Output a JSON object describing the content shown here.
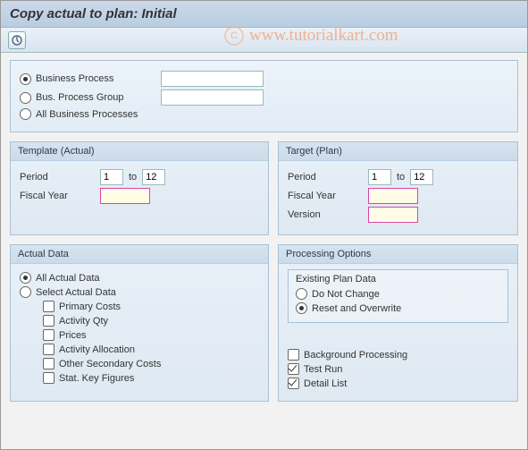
{
  "title": "Copy actual to plan: Initial",
  "watermark": "www.tutorialkart.com",
  "selection": {
    "opt_business_process": "Business Process",
    "opt_bus_process_group": "Bus. Process Group",
    "opt_all_business_processes": "All Business Processes",
    "bp_value": "",
    "bpg_value": ""
  },
  "template": {
    "title": "Template (Actual)",
    "period_label": "Period",
    "period_from": "1",
    "to_label": "to",
    "period_to": "12",
    "fiscal_year_label": "Fiscal Year",
    "fiscal_year_value": ""
  },
  "target": {
    "title": "Target (Plan)",
    "period_label": "Period",
    "period_from": "1",
    "to_label": "to",
    "period_to": "12",
    "fiscal_year_label": "Fiscal Year",
    "fiscal_year_value": "",
    "version_label": "Version",
    "version_value": ""
  },
  "actual": {
    "title": "Actual Data",
    "opt_all": "All Actual Data",
    "opt_select": "Select Actual Data",
    "cb_primary_costs": "Primary Costs",
    "cb_activity_qty": "Activity Qty",
    "cb_prices": "Prices",
    "cb_activity_allocation": "Activity Allocation",
    "cb_other_secondary": "Other Secondary Costs",
    "cb_stat_key": "Stat. Key Figures"
  },
  "processing": {
    "title": "Processing Options",
    "existing_title": "Existing Plan Data",
    "opt_do_not_change": "Do Not Change",
    "opt_reset_overwrite": "Reset and Overwrite",
    "cb_background": "Background Processing",
    "cb_test_run": "Test Run",
    "cb_detail_list": "Detail List"
  }
}
